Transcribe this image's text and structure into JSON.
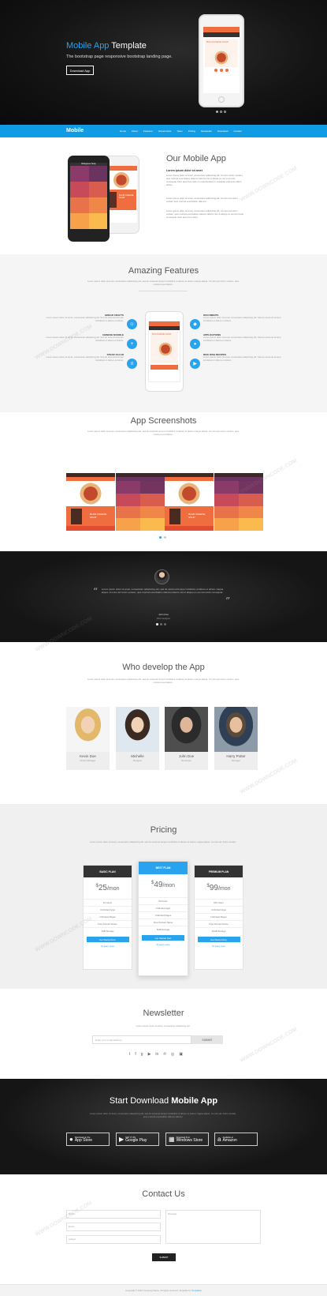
{
  "hero": {
    "title_accent": "Mobile App",
    "title_rest": " Template",
    "subtitle": "The bootstrap page responsive bootstrap landing page.",
    "button": "Download App",
    "phone_card_title": "BOLOGNESE SOUP"
  },
  "nav": {
    "logo": "Mobile",
    "items": [
      "Home",
      "About",
      "Features",
      "Screenshots",
      "Team",
      "Pricing",
      "Newsletter",
      "Download",
      "Contact"
    ]
  },
  "about": {
    "title": "Our Mobile App",
    "subtitle": "Lorem ipsum dolor sit amet",
    "paragraphs": [
      "Lorem ipsum dolor sit amet, consectetur adipiscing elit. Ut enim minim veniam, quis nostrud exercitation ullamco laboris nisi ut aliquip ex ea commodo consequat. Duis aute irure dolor in reprehenderit in voluptate velit esse cillum dolore.",
      "Lorem ipsum dolor sit amet, consectetur adipiscing elit. Ut enim ad minim veniam quis nostrud exercitation ullamco.",
      "Lorem ipsum dolor sit amet, consectetur adipiscing elit. Ut enim ad minim veniam, quis nostrud exercitation ullamco laboris nisi ut aliquip ex ea commodo consequat. Duis aute irure dolor."
    ],
    "black_phone_header": "Bolognese Soup",
    "white_phone_card": "BLAM CHEESE SOUP"
  },
  "features": {
    "title": "Amazing Features",
    "description": "Lorem ipsum dolor sit amet, consectetur adipisicing elit, sed do eiusmod tempor incididunt ut labore et dolore magna aliqua. Ut enim ad minim veniam, quis nostrud exercitation.",
    "left": [
      {
        "title": "Bread Crafts",
        "text": "Lorem ipsum dolor sit amet, consectetur adipiscing elit. Sed do eiusmod tempor incididunt ut labore et dolore."
      },
      {
        "title": "Chinese Noodle",
        "text": "Lorem ipsum dolor sit amet, consectetur adipiscing elit. Sed do eiusmod tempor incididunt ut labore et dolore."
      },
      {
        "title": "Steak Salad",
        "text": "Lorem ipsum dolor sit amet, consectetur adipiscing elit. Sed do eiusmod tempor incididunt ut labore et dolore."
      }
    ],
    "right": [
      {
        "title": "Documents",
        "text": "Lorem ipsum dolor sit amet, consectetur adipiscing elit. Sed do eiusmod tempor incididunt ut labore et dolore."
      },
      {
        "title": "Applications",
        "text": "Lorem ipsum dolor sit amet, consectetur adipiscing elit. Sed do eiusmod tempor incididunt ut labore et dolore."
      },
      {
        "title": "Rice Dish Recipes",
        "text": "Lorem ipsum dolor sit amet, consectetur adipiscing elit. Sed do eiusmod tempor incididunt ut labore et dolore."
      }
    ],
    "left_icons": [
      "users-icon",
      "plus-icon",
      "layers-icon"
    ],
    "right_icons": [
      "diamond-icon",
      "apple-icon",
      "play-icon"
    ],
    "left_glyphs": [
      "☺",
      "+",
      "≡"
    ],
    "right_glyphs": [
      "◆",
      "●",
      "▶"
    ]
  },
  "screenshots": {
    "title": "App Screenshots",
    "description": "Lorem ipsum dolor sit amet, consectetur adipisicing elit, sed do eiusmod tempor incididunt ut labore et dolore magna aliqua. Ut enim ad minim veniam, quis nostrud exercitation.",
    "card_label": "BLAM CHEESE SOUP"
  },
  "testimonial": {
    "quote": "Lorem ipsum dolor sit amet, consectetur adipisicing elit, sed do eiusmod tempor incididunt ut labore et dolore magna aliqua. Ut enim ad minim veniam, quis nostrud exercitation ullamco laboris nisi ut aliquip ex ea commodo consequat.",
    "name": "John Doe",
    "role": "Web designer"
  },
  "team": {
    "title": "Who develop the App",
    "description": "Lorem ipsum dolor sit amet, consectetur adipisicing elit, sed do eiusmod tempor incididunt ut labore et dolore magna aliqua. Ut enim ad minim veniam, quis nostrud exercitation.",
    "members": [
      {
        "name": "Kevin Doe",
        "role": "Senior Manager"
      },
      {
        "name": "Michelle",
        "role": "Designer"
      },
      {
        "name": "John Doe",
        "role": "Developer"
      },
      {
        "name": "Harry Potter",
        "role": "Manager"
      }
    ]
  },
  "pricing": {
    "title": "Pricing",
    "description": "Lorem ipsum dolor sit amet, consectetur adipisicing elit, sed do eiusmod tempor incididunt ut labore et dolore magna aliqua. Ut enim ad minim veniam.",
    "plans": [
      {
        "name": "BASIC PLAN",
        "currency": "$",
        "amount": "25",
        "period": "/mon",
        "features": [
          "10 Users",
          "Unlimited Apps",
          "Unlimited Pages",
          "Free Domain Name",
          "1GB Storage"
        ],
        "button": "Get Started Now",
        "more": "Or learn more"
      },
      {
        "name": "BEST PLAN",
        "currency": "$",
        "amount": "49",
        "period": "/mon",
        "features": [
          "50 Users",
          "Unlimited Apps",
          "Unlimited Pages",
          "Free Domain Name",
          "5GB Storage"
        ],
        "button": "Get Started Now",
        "more": "Or learn more"
      },
      {
        "name": "PREMIUM PLAN",
        "currency": "$",
        "amount": "99",
        "period": "/mon",
        "features": [
          "100 Users",
          "Unlimited Apps",
          "Unlimited Pages",
          "Free Domain Name",
          "10GB Storage"
        ],
        "button": "Get Started Now",
        "more": "Or learn more"
      }
    ]
  },
  "newsletter": {
    "title": "Newsletter",
    "description": "Lorem ipsum dolor sit amet, consectetur adipisicing elit.",
    "placeholder": "Enter your email address",
    "button": "SUBMIT",
    "social_icons": [
      "twitter-icon",
      "facebook-icon",
      "google-plus-icon",
      "youtube-icon",
      "linkedin-icon",
      "pinterest-icon",
      "dribbble-icon",
      "instagram-icon"
    ],
    "social_glyphs": [
      "t",
      "f",
      "g",
      "▶",
      "in",
      "℗",
      "◎",
      "▣"
    ]
  },
  "download": {
    "title_light": "Start Download ",
    "title_bold": "Mobile App",
    "description": "Lorem ipsum dolor sit amet, consectetur adipisicing elit, sed do eiusmod tempor incididunt ut labore et dolore magna aliqua. Ut enim ad minim veniam, quis nostrud exercitation ullamco laboris.",
    "stores": [
      {
        "small": "Download on the",
        "big": "App Store",
        "icon": "apple-icon",
        "glyph": "●"
      },
      {
        "small": "GET IT ON",
        "big": "Google Play",
        "icon": "google-play-icon",
        "glyph": "▶"
      },
      {
        "small": "Download from",
        "big": "Windows Store",
        "icon": "windows-icon",
        "glyph": "▦"
      },
      {
        "small": "Available at",
        "big": "Amazon",
        "icon": "amazon-icon",
        "glyph": "a"
      }
    ]
  },
  "contact": {
    "title": "Contact Us",
    "name_placeholder": "Name",
    "email_placeholder": "Email",
    "subject_placeholder": "Subject",
    "message_placeholder": "Message",
    "button": "SUBMIT"
  },
  "footer": {
    "text": "Copyright © 2015 Company Name. All rights reserved. Template by ",
    "link": "Templates"
  },
  "watermark": "WWW.DOWNCODE.COM",
  "colors": {
    "accent": "#109be5",
    "orange": "#ef6d3f",
    "dark": "#151515"
  }
}
